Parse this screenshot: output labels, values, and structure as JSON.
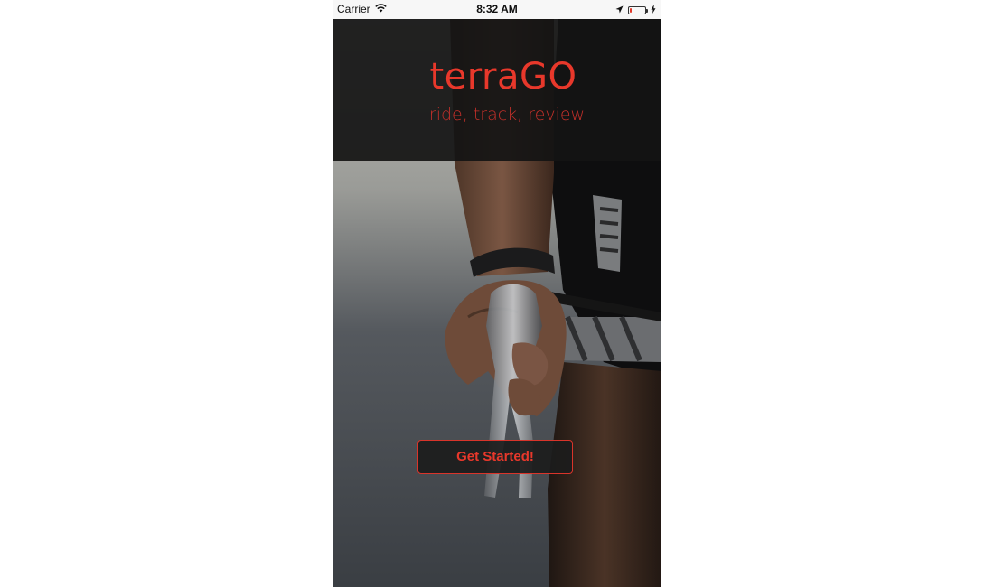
{
  "status_bar": {
    "carrier": "Carrier",
    "time": "8:32 AM",
    "wifi_icon": "wifi-icon",
    "location_icon": "location-arrow-icon",
    "battery_icon": "battery-icon",
    "charging_icon": "bolt-icon",
    "battery_level": 0.15
  },
  "header": {
    "title": "terraGO",
    "tagline": "ride, track, review"
  },
  "actions": {
    "get_started_label": "Get Started!"
  },
  "colors": {
    "accent": "#e8382b",
    "header_bg": "#141414",
    "status_bg": "#f7f7f7"
  }
}
